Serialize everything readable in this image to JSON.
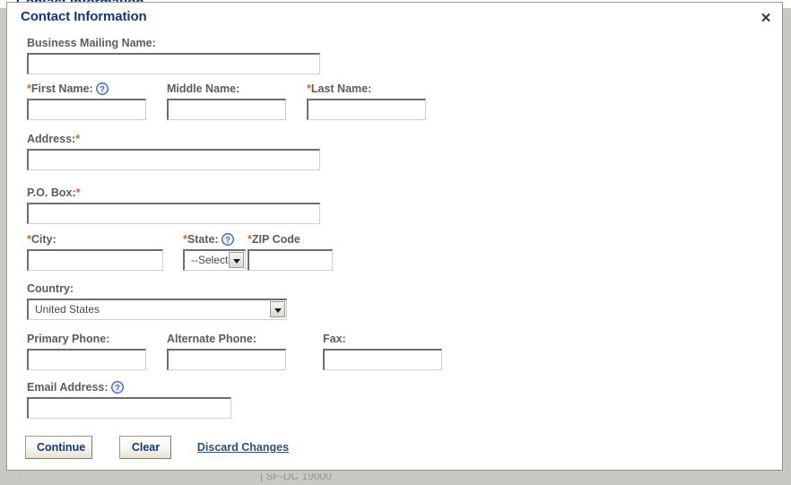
{
  "background": {
    "top_clipped_text": "Contact Information",
    "bottom_clipped_text": "| SF-DC 19000",
    "bottom_left_clipped_text": "  -        -"
  },
  "dialog": {
    "title": "Contact Information",
    "close_label": "✕",
    "close_icon": "close-icon"
  },
  "fields": {
    "business_mailing_name": {
      "label": "Business Mailing Name:",
      "value": "",
      "required": false,
      "help": false
    },
    "first_name": {
      "label": "First Name:",
      "value": "",
      "required": true,
      "required_marker": "*",
      "help": true,
      "help_icon": "help-question-icon"
    },
    "middle_name": {
      "label": "Middle Name:",
      "value": "",
      "required": false,
      "help": false
    },
    "last_name": {
      "label": "Last Name:",
      "value": "",
      "required": true,
      "required_marker": "*",
      "help": false
    },
    "address": {
      "label": "Address:",
      "value": "",
      "required": true,
      "required_marker": "*",
      "help": false
    },
    "po_box": {
      "label": "P.O. Box:",
      "value": "",
      "required": true,
      "required_marker": "*",
      "help": false
    },
    "city": {
      "label": "City:",
      "value": "",
      "required": true,
      "required_marker": "*",
      "help": false
    },
    "state": {
      "label": "State:",
      "selected": "--Select",
      "required": true,
      "required_marker": "*",
      "help": true,
      "help_icon": "help-question-icon"
    },
    "zip_code": {
      "label": "ZIP Code",
      "value": "",
      "required": true,
      "required_marker": "*",
      "help": false
    },
    "country": {
      "label": "Country:",
      "selected": "United States",
      "required": false,
      "help": false
    },
    "primary_phone": {
      "label": "Primary Phone:",
      "value": "",
      "required": false,
      "help": false
    },
    "alternate_phone": {
      "label": "Alternate Phone:",
      "value": "",
      "required": false,
      "help": false
    },
    "fax": {
      "label": "Fax:",
      "value": "",
      "required": false,
      "help": false
    },
    "email_address": {
      "label": "Email Address:",
      "value": "",
      "required": false,
      "help": true,
      "help_icon": "help-question-icon"
    }
  },
  "actions": {
    "continue_label": "Continue",
    "clear_label": "Clear",
    "discard_label": "Discard Changes"
  },
  "colors": {
    "title_blue": "#13377e",
    "required_orange": "#d2691e",
    "label_gray": "#5c5c5c",
    "button_text": "#12377d",
    "link_blue": "#2f4f73",
    "help_icon_blue": "#3b63ad",
    "page_background": "#c9c9c4"
  }
}
